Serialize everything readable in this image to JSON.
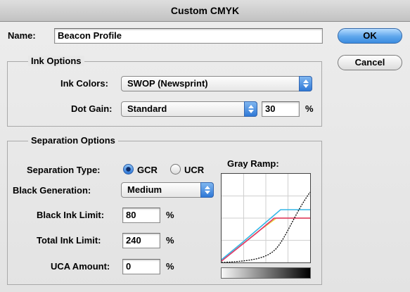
{
  "window": {
    "title": "Custom CMYK"
  },
  "name_field": {
    "label": "Name:",
    "value": "Beacon Profile"
  },
  "buttons": {
    "ok": "OK",
    "cancel": "Cancel"
  },
  "ink_options": {
    "title": "Ink Options",
    "ink_colors": {
      "label": "Ink Colors:",
      "value": "SWOP (Newsprint)"
    },
    "dot_gain": {
      "label": "Dot Gain:",
      "value": "Standard",
      "amount": "30",
      "unit": "%"
    }
  },
  "separation_options": {
    "title": "Separation Options",
    "separation_type": {
      "label": "Separation Type:",
      "options": [
        "GCR",
        "UCR"
      ],
      "selected": "GCR"
    },
    "black_generation": {
      "label": "Black Generation:",
      "value": "Medium"
    },
    "black_ink_limit": {
      "label": "Black Ink Limit:",
      "value": "80",
      "unit": "%"
    },
    "total_ink_limit": {
      "label": "Total Ink Limit:",
      "value": "240",
      "unit": "%"
    },
    "uca_amount": {
      "label": "UCA Amount:",
      "value": "0",
      "unit": "%"
    },
    "gray_ramp": {
      "label": "Gray Ramp:"
    }
  },
  "colors": {
    "cyan_curve": "#33b6e6",
    "magenta_curve": "#e0336e",
    "yellow_curve": "#ead83a",
    "black_curve": "#000000",
    "accent": "#3b8be0"
  }
}
